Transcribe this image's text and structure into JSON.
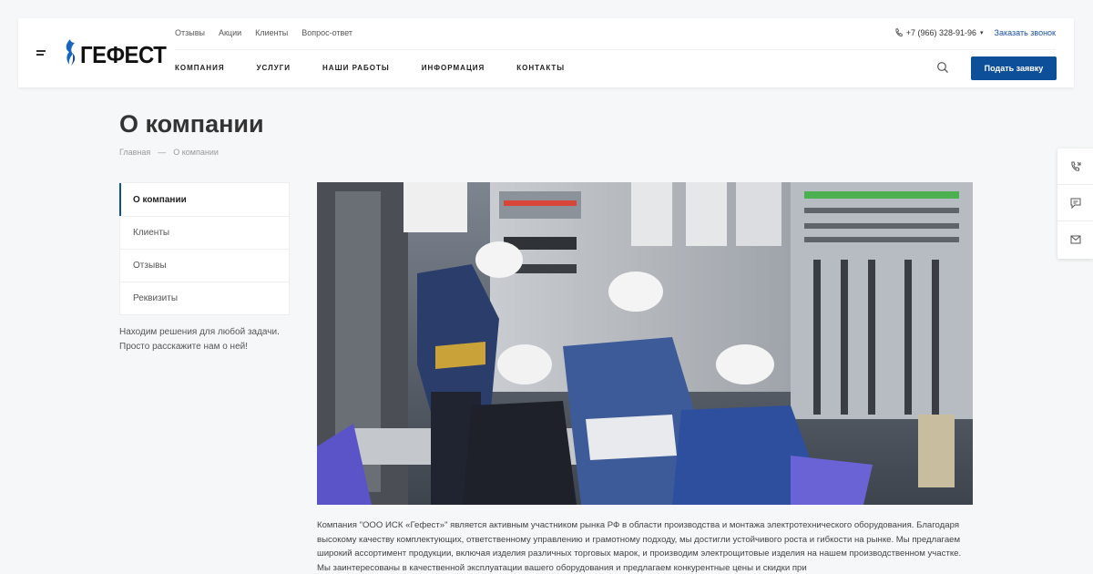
{
  "header": {
    "logo_text": "ГЕФЕСТ",
    "top_links": [
      "Отзывы",
      "Акции",
      "Клиенты",
      "Вопрос-ответ"
    ],
    "main_nav": [
      "КОМПАНИЯ",
      "УСЛУГИ",
      "НАШИ РАБОТЫ",
      "ИНФОРМАЦИЯ",
      "КОНТАКТЫ"
    ],
    "phone": "+7 (966) 328-91-96",
    "call_link": "Заказать звонок",
    "cta_label": "Подать заявку"
  },
  "page": {
    "title": "О компании",
    "breadcrumb": [
      "Главная",
      "—",
      "О компании"
    ]
  },
  "sidemenu": {
    "items": [
      "О компании",
      "Клиенты",
      "Отзывы",
      "Реквизиты"
    ],
    "note": "Находим решения для любой задачи. Просто расскажите нам о ней!"
  },
  "content": {
    "text": "Компания \"ООО ИСК «Гефест»\" является активным участником рынка РФ в области производства и монтажа электротехнического оборудования. Благодаря высокому качеству комплектующих, ответственному управлению и грамотному подходу, мы достигли устойчивого роста и гибкости на рынке. Мы предлагаем широкий ассортимент продукции, включая изделия различных торговых марок, и производим электрощитовые изделия на нашем производственном участке. Мы заинтересованы в качественной эксплуатации вашего оборудования и предлагаем конкурентные цены и скидки при"
  },
  "colors": {
    "accent": "#0d4f99",
    "link": "#1a4fa0",
    "background": "#f6f7f8"
  },
  "icons": {
    "burger": "menu-icon",
    "phone": "phone-icon",
    "search": "search-icon",
    "float": [
      "callback-icon",
      "chat-icon",
      "mail-icon"
    ]
  }
}
